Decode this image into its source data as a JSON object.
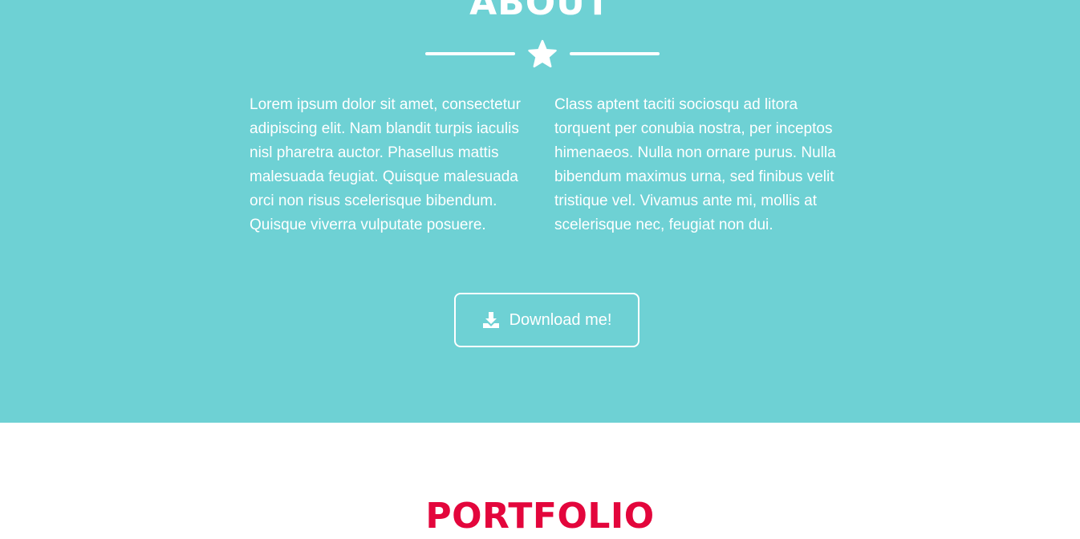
{
  "colors": {
    "about_background": "#6ed1d4",
    "portfolio_background": "#ffffff",
    "portfolio_title": "#e3063c",
    "text_on_teal": "#ffffff"
  },
  "about": {
    "title": "ABOUT",
    "divider_icon": "star-icon",
    "columns": [
      "Lorem ipsum dolor sit amet, consectetur adipiscing elit. Nam blandit turpis iaculis nisl pharetra auctor. Phasellus mattis malesuada feugiat. Quisque malesuada orci non risus scelerisque bibendum. Quisque viverra vulputate posuere.",
      "Class aptent taciti sociosqu ad litora torquent per conubia nostra, per inceptos himenaeos. Nulla non ornare purus. Nulla bibendum maximus urna, sed finibus velit tristique vel. Vivamus ante mi, mollis at scelerisque nec, feugiat non dui."
    ],
    "download_button": {
      "icon": "download-icon",
      "label": "Download me!"
    }
  },
  "portfolio": {
    "title": "PORTFOLIO"
  }
}
